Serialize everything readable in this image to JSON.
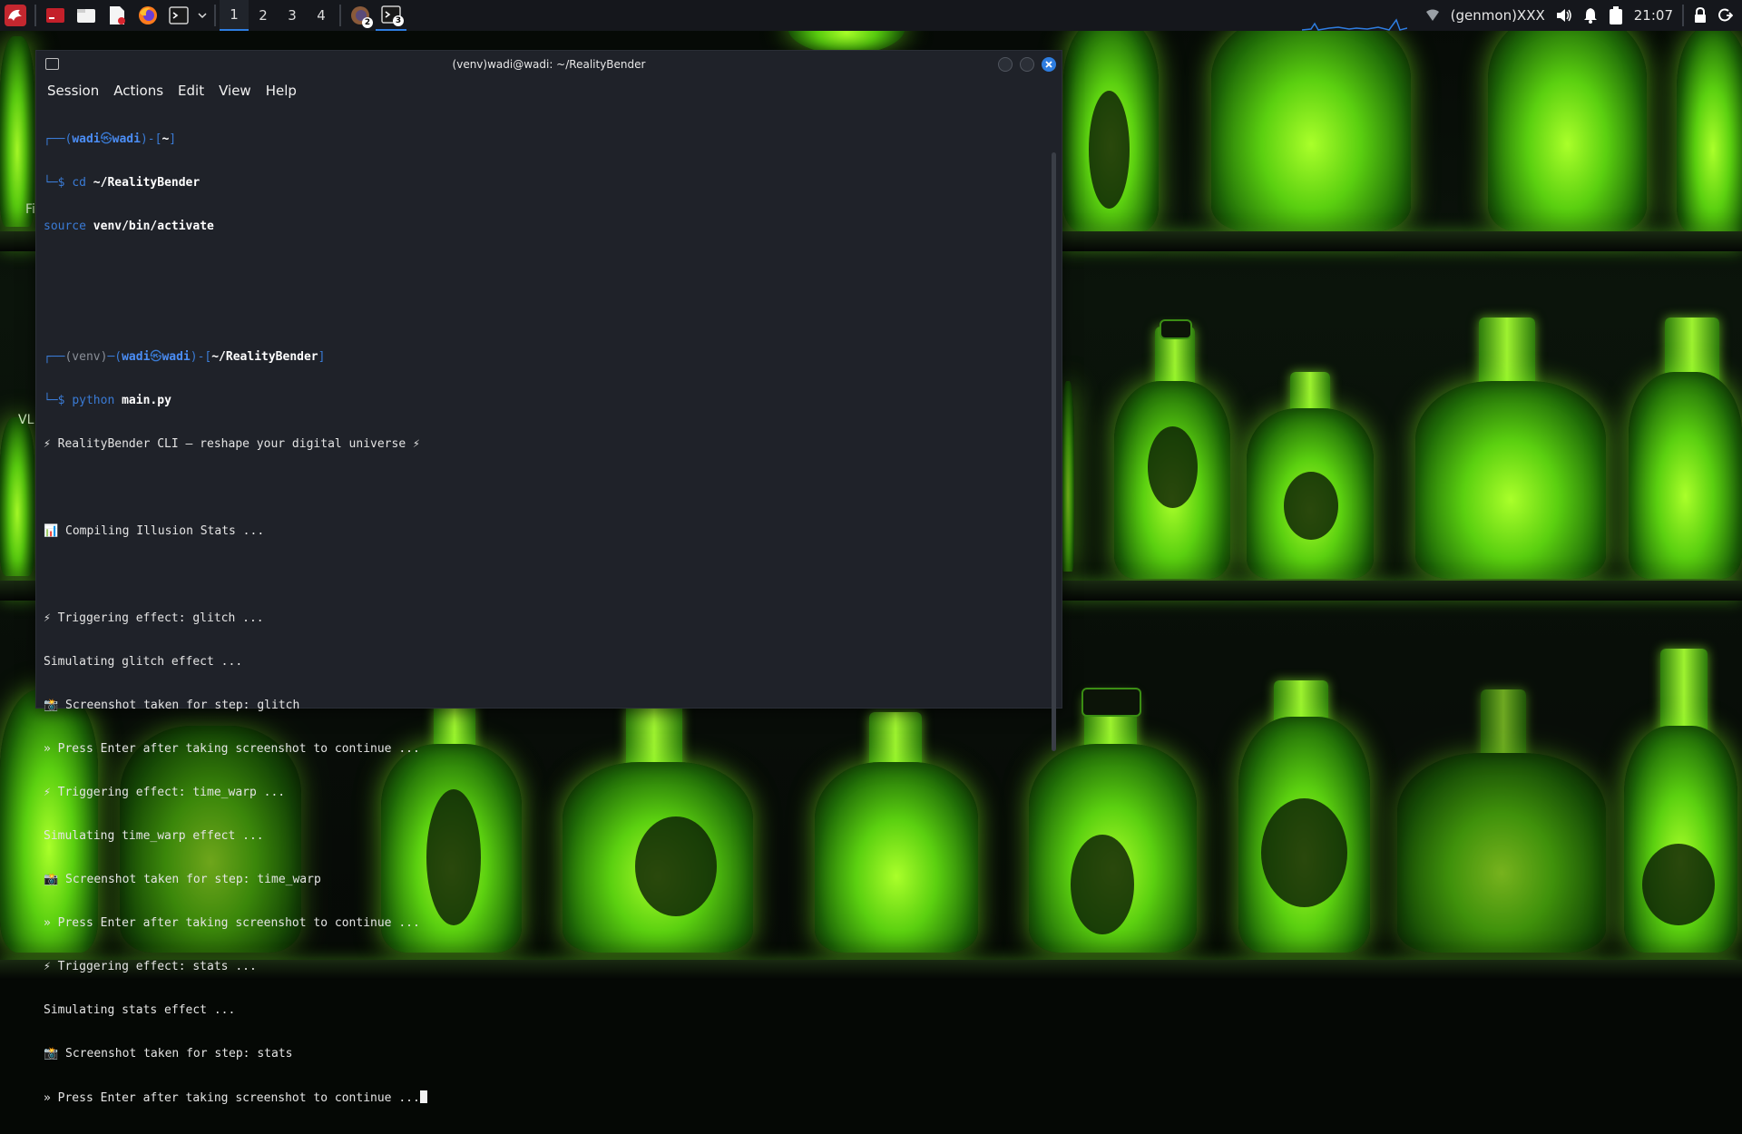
{
  "panel": {
    "workspaces": [
      "1",
      "2",
      "3",
      "4"
    ],
    "active_workspace": "1",
    "firefox_badge": "2",
    "terminal_badge": "3",
    "genmon": "(genmon)XXX",
    "clock": "21:07"
  },
  "window": {
    "title": "(venv)wadi@wadi: ~/RealityBender",
    "menu": [
      "Session",
      "Actions",
      "Edit",
      "View",
      "Help"
    ]
  },
  "terminal": {
    "p1_user": "wadi",
    "p1_host": "wadi",
    "p1_dir": "~",
    "cmd1_a": "cd",
    "cmd1_b": "~/RealityBender",
    "cmd2_a": "source",
    "cmd2_b": "venv/bin/activate",
    "p2_venv": "(venv)",
    "p2_user": "wadi",
    "p2_host": "wadi",
    "p2_dir": "~/RealityBender",
    "cmd3_a": "python",
    "cmd3_b": "main.py",
    "output": [
      "⚡ RealityBender CLI — reshape your digital universe ⚡",
      "",
      "📊 Compiling Illusion Stats ...",
      "",
      "⚡ Triggering effect: glitch ...",
      "Simulating glitch effect ...",
      "📸 Screenshot taken for step: glitch",
      "» Press Enter after taking screenshot to continue ...",
      "⚡ Triggering effect: time_warp ...",
      "Simulating time_warp effect ...",
      "📸 Screenshot taken for step: time_warp",
      "» Press Enter after taking screenshot to continue ...",
      "⚡ Triggering effect: stats ...",
      "Simulating stats effect ...",
      "📸 Screenshot taken for step: stats",
      "» Press Enter after taking screenshot to continue ..."
    ]
  },
  "desktop_fragments": [
    "Fi",
    "VL"
  ],
  "colors": {
    "panel": "#15171c",
    "terminal_bg": "#1f2229",
    "prompt_blue": "#3a7bd5",
    "close_button": "#2e7de0",
    "wallpaper_glow": "#7fe21c"
  }
}
